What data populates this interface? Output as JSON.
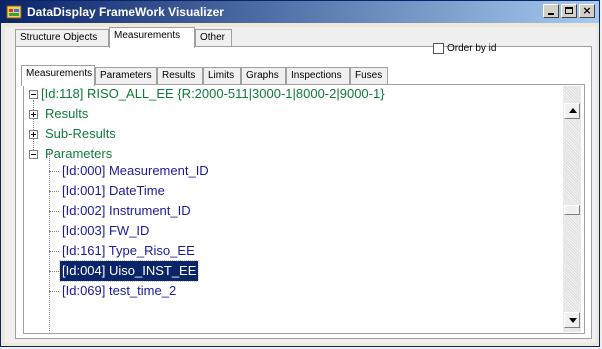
{
  "window": {
    "title": "DataDisplay FrameWork Visualizer",
    "buttons": {
      "minimize": "_",
      "maximize": "□",
      "close": "×"
    }
  },
  "top_tabs": [
    {
      "label": "Structure Objects",
      "active": false
    },
    {
      "label": "Measurements",
      "active": true
    },
    {
      "label": "Other",
      "active": false
    }
  ],
  "order_by_id": {
    "label": "Order by id",
    "checked": false
  },
  "inner_tabs": [
    {
      "label": "Measurements",
      "active": true
    },
    {
      "label": "Parameters",
      "active": false
    },
    {
      "label": "Results",
      "active": false
    },
    {
      "label": "Limits",
      "active": false
    },
    {
      "label": "Graphs",
      "active": false
    },
    {
      "label": "Inspections",
      "active": false
    },
    {
      "label": "Fuses",
      "active": false
    }
  ],
  "tree": {
    "root": {
      "label": "[Id:118] RISO_ALL_EE {R:2000-511|3000-1|8000-2|9000-1}",
      "expanded": true
    },
    "results": {
      "label": "Results",
      "expanded": false
    },
    "sub_results": {
      "label": "Sub-Results",
      "expanded": false
    },
    "parameters": {
      "label": "Parameters",
      "expanded": true,
      "children": [
        {
          "label": "[Id:000] Measurement_ID"
        },
        {
          "label": "[Id:001] DateTime"
        },
        {
          "label": "[Id:002] Instrument_ID"
        },
        {
          "label": "[Id:003] FW_ID"
        },
        {
          "label": "[Id:161] Type_Riso_EE"
        },
        {
          "label": "[Id:004] Uiso_INST_EE",
          "selected": true
        },
        {
          "label": "[Id:069] test_time_2"
        }
      ]
    }
  },
  "colors": {
    "title_gradient_start": "#0a246a",
    "title_gradient_end": "#a6caf0",
    "tree_group_text": "#0e7a3a",
    "tree_leaf_text": "#1a1a9a",
    "selection_background": "#0a246a"
  }
}
